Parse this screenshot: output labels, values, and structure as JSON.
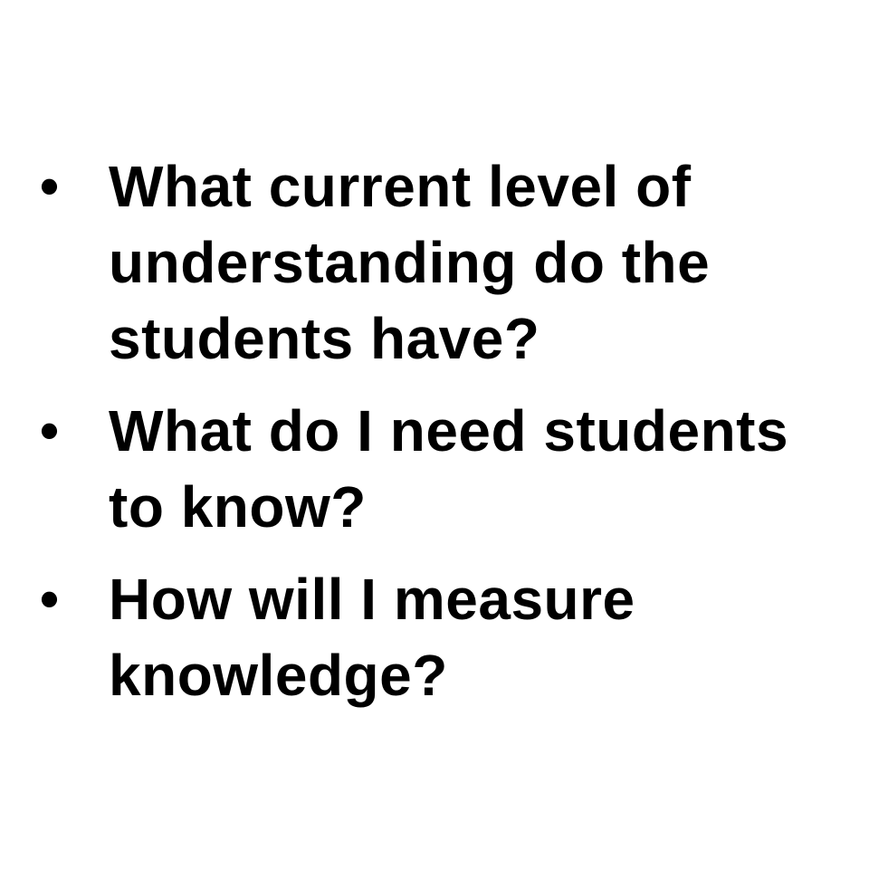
{
  "bullets": [
    {
      "marker": "•",
      "text": "What current level of understanding do the students have?"
    },
    {
      "marker": "•",
      "text": "What do I need students to know?"
    },
    {
      "marker": "•",
      "text": "How will I measure knowledge?"
    }
  ]
}
